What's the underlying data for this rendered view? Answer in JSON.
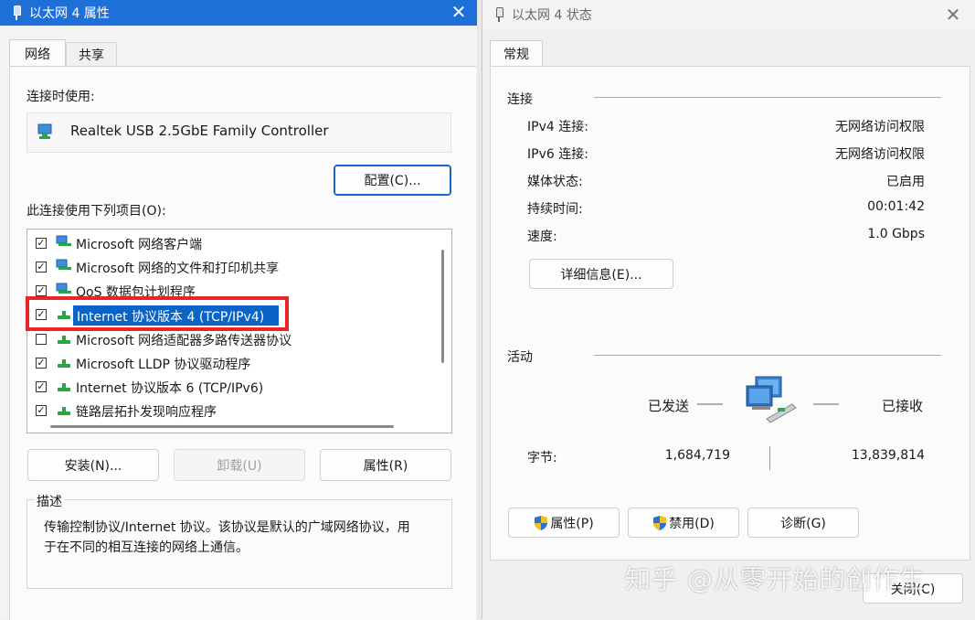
{
  "props_window": {
    "title": "以太网 4 属性",
    "tabs": [
      "网络",
      "共享"
    ],
    "connect_using_label": "连接时使用:",
    "adapter_name": "Realtek USB 2.5GbE Family Controller",
    "configure_button": "配置(C)...",
    "items_label": "此连接使用下列项目(O):",
    "items": [
      {
        "label": "Microsoft 网络客户端",
        "checked": true,
        "icon": "network-client-icon"
      },
      {
        "label": "Microsoft 网络的文件和打印机共享",
        "checked": true,
        "icon": "file-printer-sharing-icon"
      },
      {
        "label": "QoS 数据包计划程序",
        "checked": true,
        "icon": "qos-icon"
      },
      {
        "label": "Internet 协议版本 4 (TCP/IPv4)",
        "checked": true,
        "icon": "protocol-icon",
        "selected": true
      },
      {
        "label": "Microsoft 网络适配器多路传送器协议",
        "checked": false,
        "icon": "protocol-icon"
      },
      {
        "label": "Microsoft LLDP 协议驱动程序",
        "checked": true,
        "icon": "protocol-icon"
      },
      {
        "label": "Internet 协议版本 6 (TCP/IPv6)",
        "checked": true,
        "icon": "protocol-icon"
      },
      {
        "label": "链路层拓扑发现响应程序",
        "checked": true,
        "icon": "protocol-icon"
      }
    ],
    "install_button": "安装(N)...",
    "uninstall_button": "卸载(U)",
    "properties_button": "属性(R)",
    "description_title": "描述",
    "description_line1": "传输控制协议/Internet 协议。该协议是默认的广域网络协议，用",
    "description_line2": "于在不同的相互连接的网络上通信。",
    "highlight_color": "#e8262a",
    "selection_color": "#0a64c8"
  },
  "status_window": {
    "title": "以太网 4 状态",
    "tab": "常规",
    "connection_section": "连接",
    "rows": [
      {
        "label": "IPv4 连接:",
        "value": "无网络访问权限"
      },
      {
        "label": "IPv6 连接:",
        "value": "无网络访问权限"
      },
      {
        "label": "媒体状态:",
        "value": "已启用"
      },
      {
        "label": "持续时间:",
        "value": "00:01:42"
      },
      {
        "label": "速度:",
        "value": "1.0 Gbps"
      }
    ],
    "details_button": "详细信息(E)...",
    "activity_section": "活动",
    "sent_label": "已发送",
    "received_label": "已接收",
    "bytes_label": "字节:",
    "bytes_sent": "1,684,719",
    "bytes_received": "13,839,814",
    "properties_button": "属性(P)",
    "disable_button": "禁用(D)",
    "diagnose_button": "诊断(G)",
    "close_button": "关闭(C)"
  },
  "watermark": "知乎 @从零开始的创作生"
}
